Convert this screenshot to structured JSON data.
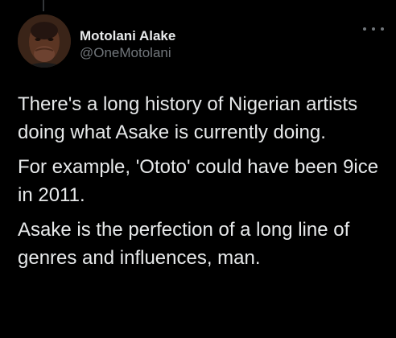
{
  "tweet": {
    "author": {
      "display_name": "Motolani Alake",
      "handle": "@OneMotolani"
    },
    "more_icon": "more-horizontal-icon",
    "paragraphs": [
      "There's a long history of Nigerian artists doing what Asake is currently doing.",
      "For example, 'Ototo' could have been 9ice in 2011.",
      "Asake is the perfection of a long line of genres and influences, man."
    ]
  },
  "colors": {
    "background": "#000000",
    "primary_text": "#e7e9ea",
    "secondary_text": "#71767b"
  }
}
